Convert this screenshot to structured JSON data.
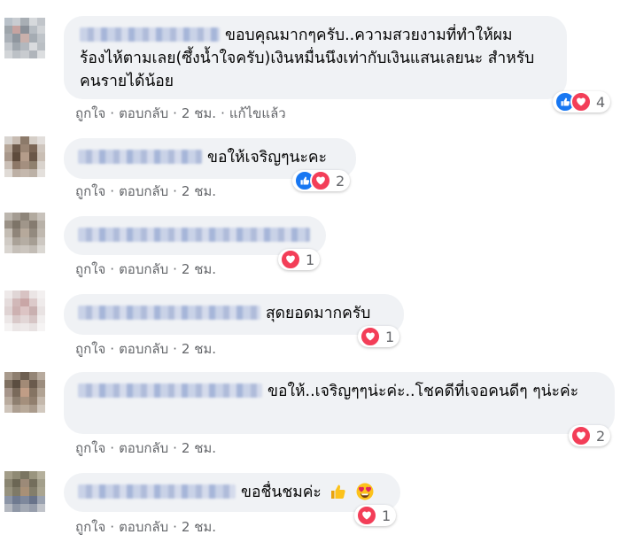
{
  "comments": [
    {
      "text": "ขอบคุณมากๆครับ..ความสวยงามที่ทำให้ผมร้องไห้ตามเลย(ซึ้งน้ำใจครับ)เงินหมื่นนึงเท่ากับเงินแสนเลยนะ สำหรับคนรายได้น้อย",
      "actions": {
        "like": "ถูกใจ",
        "reply": "ตอบกลับ",
        "time": "2 ชม.",
        "edited": "แก้ไขแล้ว"
      },
      "reaction_types": [
        "like",
        "love"
      ],
      "reaction_count": "4"
    },
    {
      "text": "ขอให้เจริญๆนะคะ",
      "actions": {
        "like": "ถูกใจ",
        "reply": "ตอบกลับ",
        "time": "2 ชม."
      },
      "reaction_types": [
        "like",
        "love"
      ],
      "reaction_count": "2"
    },
    {
      "text": "",
      "actions": {
        "like": "ถูกใจ",
        "reply": "ตอบกลับ",
        "time": "2 ชม."
      },
      "reaction_types": [
        "love"
      ],
      "reaction_count": "1"
    },
    {
      "text": "สุดยอดมากครับ",
      "actions": {
        "like": "ถูกใจ",
        "reply": "ตอบกลับ",
        "time": "2 ชม."
      },
      "reaction_types": [
        "love"
      ],
      "reaction_count": "1"
    },
    {
      "text": "ขอให้..เจริญๆๆน่ะค่ะ..โชคดีที่เจอคนดีๆ ๆน่ะค่ะ",
      "actions": {
        "like": "ถูกใจ",
        "reply": "ตอบกลับ",
        "time": "2 ชม."
      },
      "reaction_types": [
        "love"
      ],
      "reaction_count": "2"
    },
    {
      "text": "ขอชื่นชมค่ะ",
      "emojis": [
        "thumbs-up",
        "heart-eyes"
      ],
      "actions": {
        "like": "ถูกใจ",
        "reply": "ตอบกลับ",
        "time": "2 ชม."
      },
      "reaction_types": [
        "love"
      ],
      "reaction_count": "1"
    }
  ],
  "colors": {
    "like": "#1877f2",
    "love": "#f33e58",
    "bubble": "#f0f2f5",
    "meta": "#65676b"
  }
}
